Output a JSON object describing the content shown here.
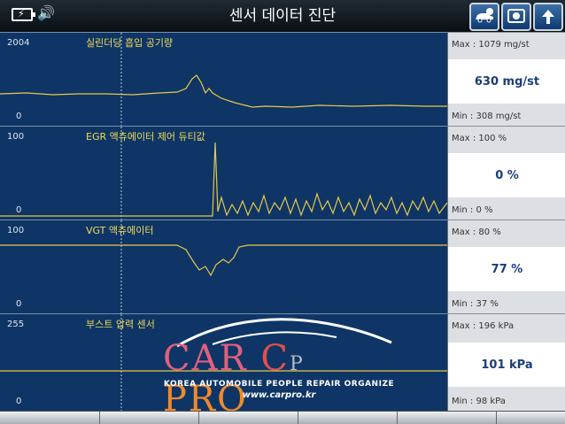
{
  "header": {
    "title": "센서 데이터 진단",
    "battery_icon": "battery-charging-icon",
    "speaker_icon": "speaker-icon",
    "buttons": [
      {
        "name": "car-badge-icon",
        "label": ""
      },
      {
        "name": "record-icon",
        "label": ""
      },
      {
        "name": "back-arrow-icon",
        "label": ""
      }
    ]
  },
  "sensors": [
    {
      "name": "실린더당 흡입 공기량",
      "scale_max": "2004",
      "scale_min": "0",
      "max": "Max :  1079 mg/st",
      "value": "630 mg/st",
      "min": "Min :   308 mg/st"
    },
    {
      "name": "EGR 액츄에이터 제어 듀티값",
      "scale_max": "100",
      "scale_min": "0",
      "max": "Max :   100 %",
      "value": "0 %",
      "min": "Min :    0 %"
    },
    {
      "name": "VGT 액츄에이터",
      "scale_max": "100",
      "scale_min": "0",
      "max": "Max :   80 %",
      "value": "77 %",
      "min": "Min :   37 %"
    },
    {
      "name": "부스트 압력 센서",
      "scale_max": "255",
      "scale_min": "0",
      "max": "Max :  196 kPa",
      "value": "101 kPa",
      "min": "Min :   98 kPa"
    }
  ],
  "logo": {
    "brand": "CAR CP PRO",
    "tagline": "KOREA AUTOMOBILE PEOPLE REPAIR ORGANIZE",
    "url": "www.carpro.kr"
  },
  "colors": {
    "graph_bg": "#0e3566",
    "trace": "#e8c84a",
    "label": "#f1dc57",
    "value_text": "#1a3d7a"
  }
}
